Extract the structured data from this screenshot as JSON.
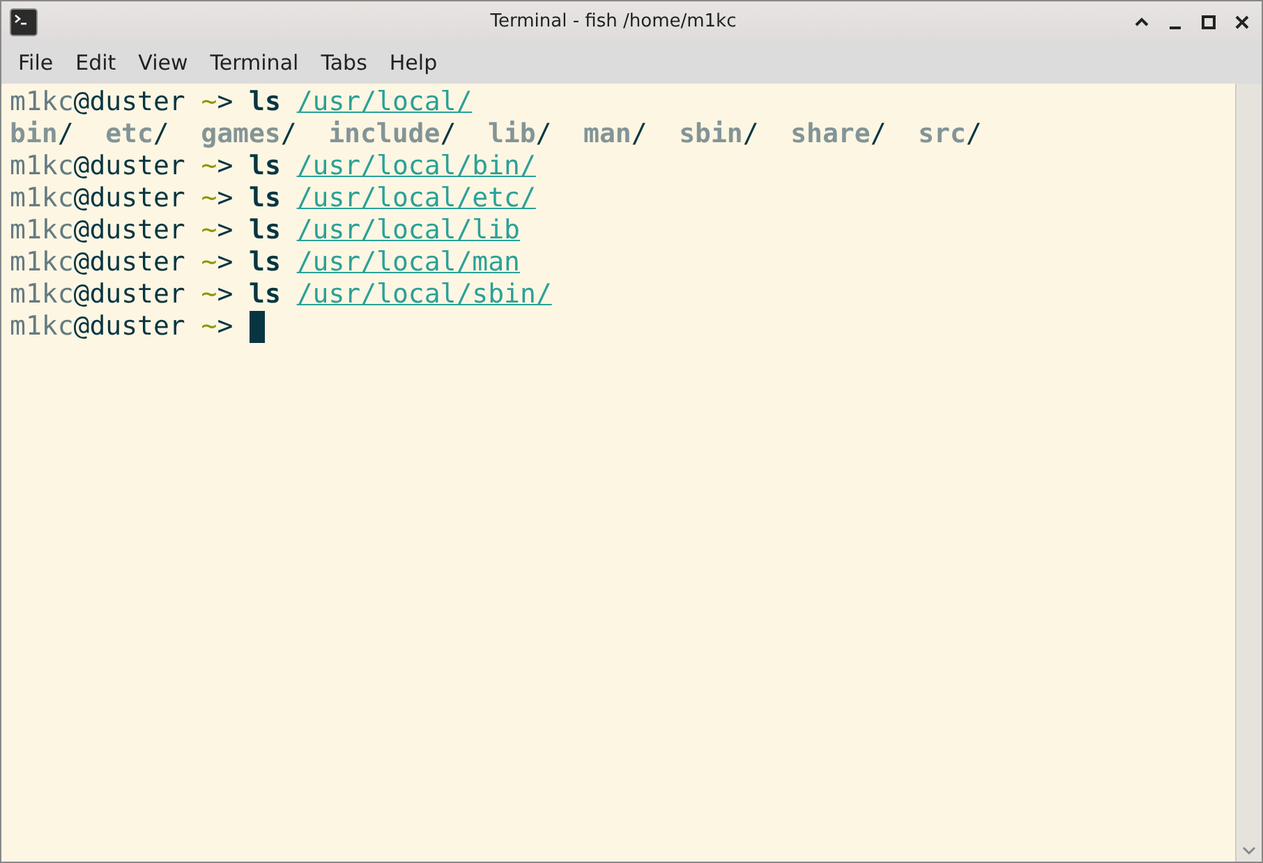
{
  "window": {
    "title": "Terminal - fish /home/m1kc"
  },
  "menu": [
    "File",
    "Edit",
    "View",
    "Terminal",
    "Tabs",
    "Help"
  ],
  "terminal": {
    "lines": [
      {
        "kind": "command",
        "user": "m1kc",
        "host": "@duster",
        "cwd": "~",
        "prompt": ">",
        "command": "ls",
        "arg": "/usr/local/"
      },
      {
        "kind": "output",
        "entries": [
          {
            "name": "bin",
            "sep": "/"
          },
          {
            "name": "etc",
            "sep": "/"
          },
          {
            "name": "games",
            "sep": "/"
          },
          {
            "name": "include",
            "sep": "/"
          },
          {
            "name": "lib",
            "sep": "/"
          },
          {
            "name": "man",
            "sep": "/"
          },
          {
            "name": "sbin",
            "sep": "/"
          },
          {
            "name": "share",
            "sep": "/"
          },
          {
            "name": "src",
            "sep": "/"
          }
        ]
      },
      {
        "kind": "command",
        "user": "m1kc",
        "host": "@duster",
        "cwd": "~",
        "prompt": ">",
        "command": "ls",
        "arg": "/usr/local/bin/"
      },
      {
        "kind": "command",
        "user": "m1kc",
        "host": "@duster",
        "cwd": "~",
        "prompt": ">",
        "command": "ls",
        "arg": "/usr/local/etc/"
      },
      {
        "kind": "command",
        "user": "m1kc",
        "host": "@duster",
        "cwd": "~",
        "prompt": ">",
        "command": "ls",
        "arg": "/usr/local/lib"
      },
      {
        "kind": "command",
        "user": "m1kc",
        "host": "@duster",
        "cwd": "~",
        "prompt": ">",
        "command": "ls",
        "arg": "/usr/local/man"
      },
      {
        "kind": "command",
        "user": "m1kc",
        "host": "@duster",
        "cwd": "~",
        "prompt": ">",
        "command": "ls",
        "arg": "/usr/local/sbin/"
      },
      {
        "kind": "prompt",
        "user": "m1kc",
        "host": "@duster",
        "cwd": "~",
        "prompt": ">",
        "cursor": true
      }
    ]
  }
}
